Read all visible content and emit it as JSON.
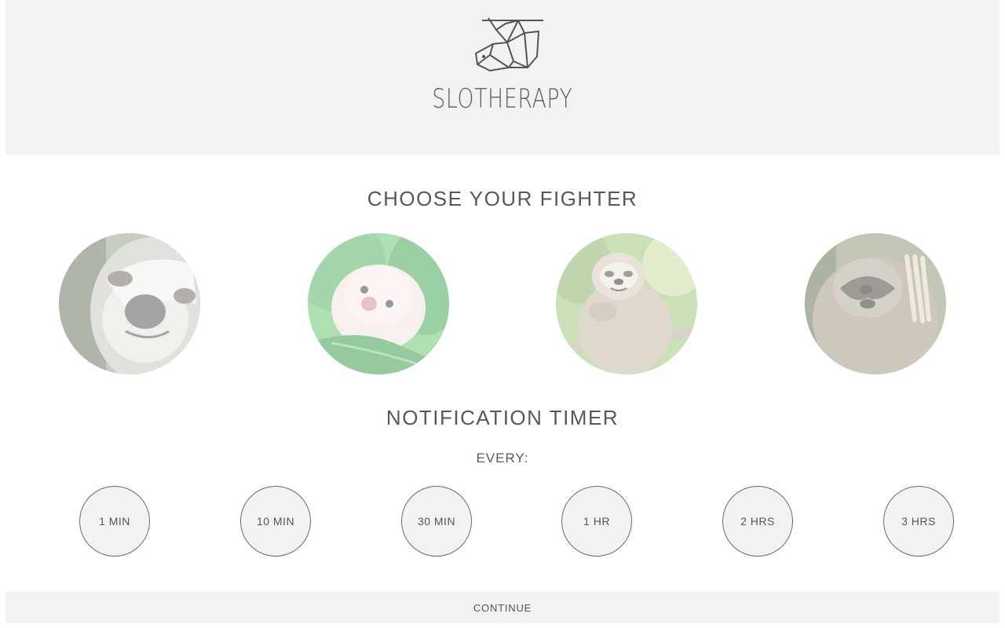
{
  "header": {
    "brand": "SLOTHERAPY",
    "logo_icon": "sloth-origami-logo-icon"
  },
  "fighters": {
    "title": "CHOOSE YOUR FIGHTER",
    "items": [
      {
        "icon": "sloth-closeup-photo",
        "bg": "#b9c2b3"
      },
      {
        "icon": "baby-sloth-photo",
        "bg": "#8fd39a"
      },
      {
        "icon": "smiling-sloth-photo",
        "bg": "#a8c889"
      },
      {
        "icon": "hanging-sloth-photo",
        "bg": "#9ea48c"
      }
    ]
  },
  "timer": {
    "title": "NOTIFICATION TIMER",
    "every_label": "EVERY:",
    "options": [
      "1 MIN",
      "10 MIN",
      "30 MIN",
      "1 HR",
      "2 HRS",
      "3 HRS"
    ]
  },
  "footer": {
    "continue_label": "CONTINUE"
  }
}
